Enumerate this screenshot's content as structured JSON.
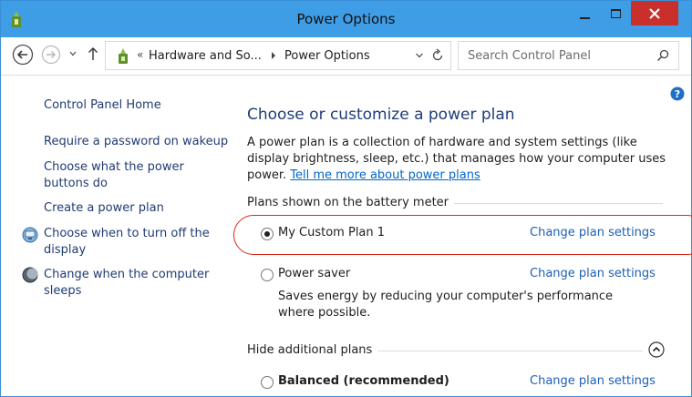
{
  "window": {
    "title": "Power Options",
    "accent_color": "#3f9de5",
    "close_color": "#c9302c"
  },
  "address_bar": {
    "prefix": "«",
    "crumbs": [
      "Hardware and So...",
      "Power Options"
    ],
    "search_placeholder": "Search Control Panel"
  },
  "left_pane": {
    "items": [
      {
        "label_lines": [
          "Control Panel Home"
        ],
        "icon": null
      },
      {
        "label_lines": [
          "Require a password on wakeup"
        ],
        "icon": null
      },
      {
        "label_lines": [
          "Choose what the power",
          "buttons do"
        ],
        "icon": null
      },
      {
        "label_lines": [
          "Create a power plan"
        ],
        "icon": null
      },
      {
        "label_lines": [
          "Choose when to turn off the",
          "display"
        ],
        "icon": "monitor-icon"
      },
      {
        "label_lines": [
          "Change when the computer",
          "sleeps"
        ],
        "icon": "moon-icon"
      }
    ]
  },
  "main": {
    "heading": "Choose or customize a power plan",
    "intro_text": "A power plan is a collection of hardware and system settings (like display brightness, sleep, etc.) that manages how your computer uses power.",
    "intro_link": "Tell me more about power plans",
    "sections": {
      "battery_meter": "Plans shown on the battery meter",
      "hidden": "Hide additional plans"
    },
    "plans": [
      {
        "name": "My Custom Plan 1",
        "selected": true,
        "bold": false,
        "link": "Change plan settings",
        "highlighted": true
      },
      {
        "name": "Power saver",
        "selected": false,
        "bold": false,
        "link": "Change plan settings",
        "description": "Saves energy by reducing your computer's performance where possible."
      },
      {
        "name": "Balanced (recommended)",
        "selected": false,
        "bold": true,
        "link": "Change plan settings"
      }
    ],
    "highlight_color": "#d9291e"
  }
}
